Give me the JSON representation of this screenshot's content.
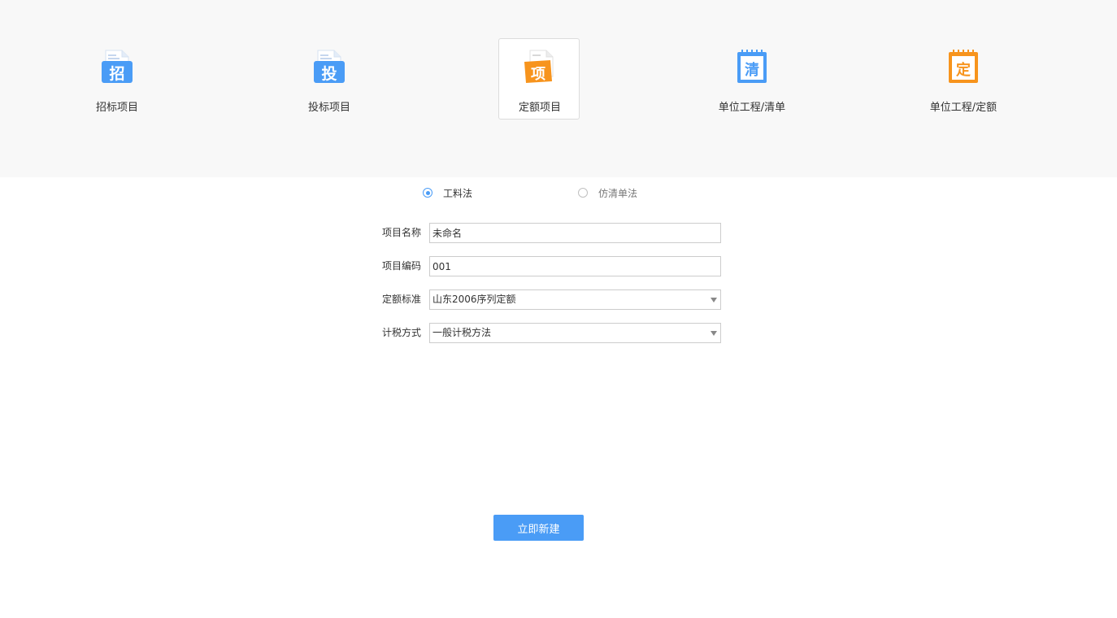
{
  "project_types": [
    {
      "label": "招标项目",
      "icon": "bid-invitation-icon",
      "glyph": "招",
      "selected": false
    },
    {
      "label": "投标项目",
      "icon": "bid-submission-icon",
      "glyph": "投",
      "selected": false
    },
    {
      "label": "定额项目",
      "icon": "quota-project-icon",
      "glyph": "项",
      "selected": true
    },
    {
      "label": "单位工程/清单",
      "icon": "unit-bill-notebook-icon",
      "glyph": "清",
      "selected": false
    },
    {
      "label": "单位工程/定额",
      "icon": "unit-quota-notebook-icon",
      "glyph": "定",
      "selected": false
    }
  ],
  "method": {
    "options": [
      {
        "label": "工料法",
        "checked": true
      },
      {
        "label": "仿清单法",
        "checked": false
      }
    ]
  },
  "form": {
    "name_label": "项目名称",
    "name_value": "未命名",
    "code_label": "项目编码",
    "code_value": "001",
    "quota_label": "定额标准",
    "quota_value": "山东2006序列定额",
    "tax_label": "计税方式",
    "tax_value": "一般计税方法"
  },
  "create_button_label": "立即新建",
  "colors": {
    "accent_blue": "#4a9cf6",
    "accent_orange": "#f7941d",
    "band_bg": "#f8f8f8"
  }
}
